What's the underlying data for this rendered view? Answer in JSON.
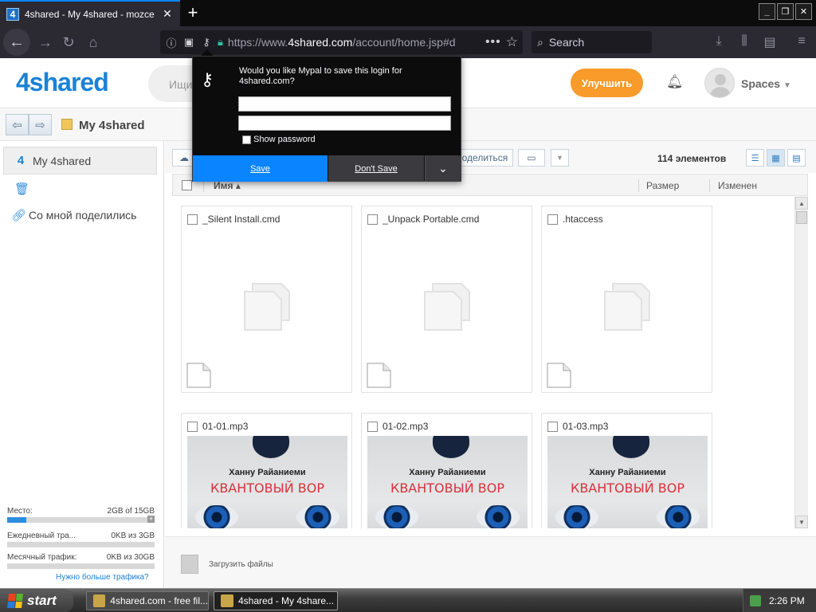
{
  "browser": {
    "tab_title": "4shared - My 4shared - mozce",
    "new_tab": "+",
    "url_prefix": "https://www.",
    "url_domain": "4shared.com",
    "url_suffix": "/account/home.jsp#d",
    "search_placeholder": "Search",
    "window_controls": [
      "_",
      "❐",
      "✕"
    ]
  },
  "site": {
    "logo": "4shared",
    "search_placeholder": "Ищи",
    "upgrade": "Улучшить",
    "spaces": "Spaces"
  },
  "breadcrumb": {
    "title": "My 4shared"
  },
  "sidebar": {
    "items": [
      {
        "label": "My 4shared",
        "icon": "4shared-icon"
      },
      {
        "label": "",
        "icon": "trash-icon"
      },
      {
        "label": "Со мной поделились",
        "icon": "link-icon"
      }
    ],
    "stats": [
      {
        "label": "Место:",
        "value": "2GB of 15GB",
        "fraction": 0.13
      },
      {
        "label": "Ежедневный тра...",
        "value": "0KB из 3GB",
        "fraction": 0
      },
      {
        "label": "Месячный трафик:",
        "value": "0KB из 30GB",
        "fraction": 0
      }
    ],
    "more_traffic": "Нужно больше трафика?"
  },
  "toolbar": {
    "share": "Поделиться",
    "count": "114 элементов"
  },
  "columns": {
    "name": "Имя",
    "size": "Размер",
    "modified": "Изменен"
  },
  "files": [
    {
      "name": "_Silent Install.cmd",
      "type": "doc"
    },
    {
      "name": "_Unpack Portable.cmd",
      "type": "doc"
    },
    {
      "name": ".htaccess",
      "type": "doc"
    },
    {
      "name": "01-01.mp3",
      "type": "audio"
    },
    {
      "name": "01-02.mp3",
      "type": "audio"
    },
    {
      "name": "01-03.mp3",
      "type": "audio"
    }
  ],
  "cover": {
    "author": "Ханну Райаниеми",
    "title": "КВАНТОВЫЙ ВОР"
  },
  "upload": {
    "label": "Загрузить файлы"
  },
  "password_prompt": {
    "message": "Would you like Mypal to save this login for 4shared.com?",
    "show_password": "Show password",
    "save": "Save",
    "dont_save": "Don't Save"
  },
  "taskbar": {
    "start": "start",
    "tasks": [
      "4shared.com - free fil...",
      "4shared - My 4share..."
    ],
    "clock": "2:26 PM"
  },
  "colors": {
    "brand": "#1a82d6",
    "upgrade": "#f89b2a",
    "save": "#0a84ff"
  }
}
